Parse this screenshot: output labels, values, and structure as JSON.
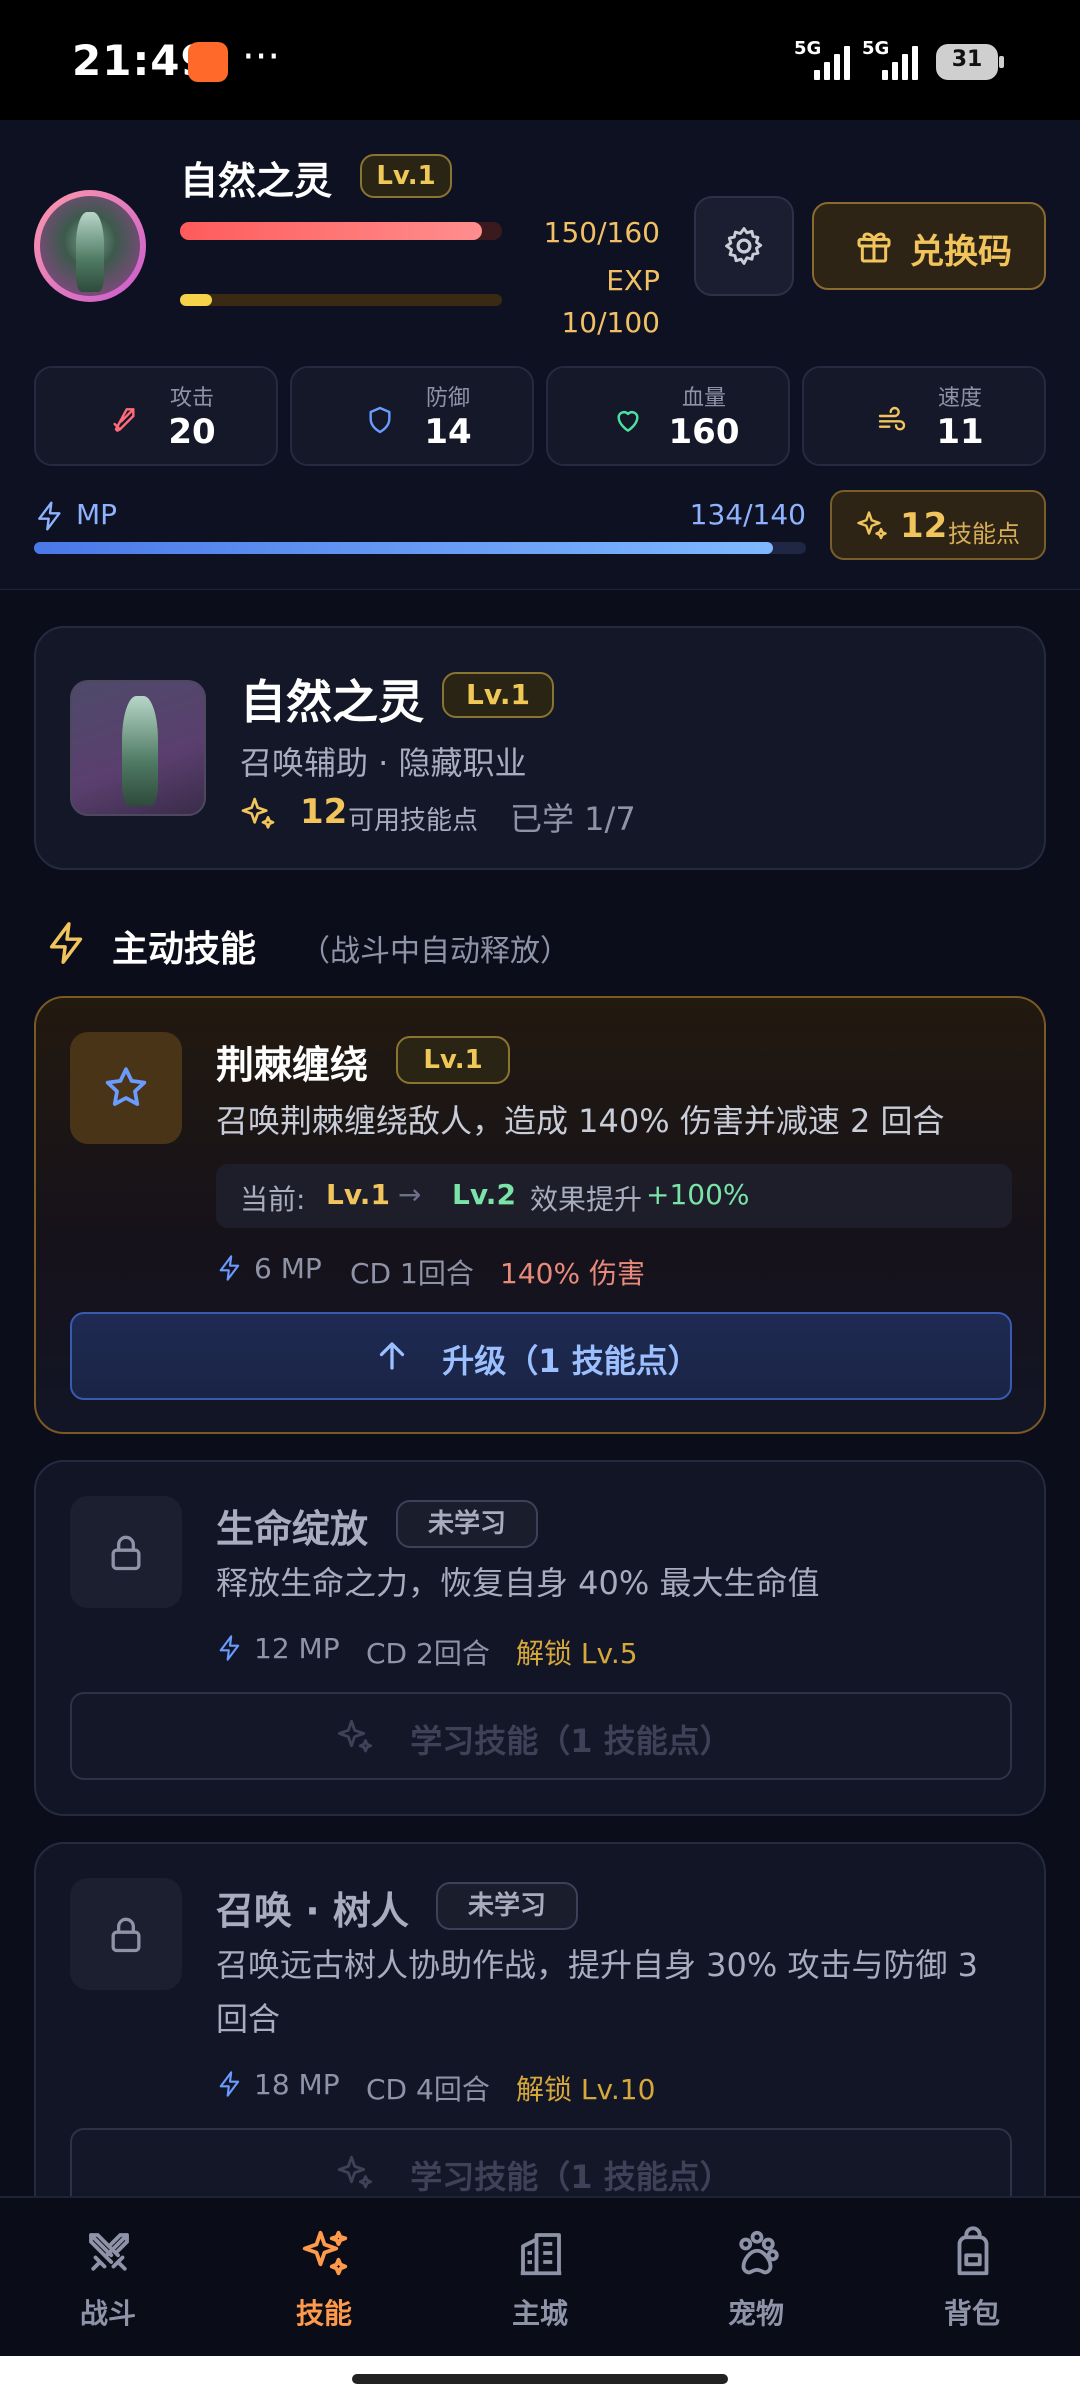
{
  "status": {
    "time": "21:49",
    "more": "···",
    "net1": "5G",
    "net2": "5G",
    "battery": "31"
  },
  "hero": {
    "name": "自然之灵",
    "level": "Lv.1",
    "hp_text": "150/160",
    "hp_ratio": 0.9375,
    "exp_label": "EXP",
    "exp_text": "10/100",
    "exp_ratio": 0.1
  },
  "header": {
    "redeem_label": "兑换码"
  },
  "stats": [
    {
      "label": "攻击",
      "value": "20",
      "icon": "sword-icon",
      "color": "#ff6b7a"
    },
    {
      "label": "防御",
      "value": "14",
      "icon": "shield-icon",
      "color": "#6a9cff"
    },
    {
      "label": "血量",
      "value": "160",
      "icon": "heart-icon",
      "color": "#4be3a2"
    },
    {
      "label": "速度",
      "value": "11",
      "icon": "wind-icon",
      "color": "#f2c55c"
    }
  ],
  "mp": {
    "label": "MP",
    "text": "134/140",
    "ratio": 0.957
  },
  "skill_points": {
    "count": "12",
    "unit": "技能点"
  },
  "class_card": {
    "name": "自然之灵",
    "level": "Lv.1",
    "subtitle": "召唤辅助 · 隐藏职业",
    "points": "12",
    "points_label": "可用技能点",
    "learned": "已学 1/7"
  },
  "section": {
    "title": "主动技能",
    "note": "（战斗中自动释放）"
  },
  "skills": [
    {
      "name": "荆棘缠绕",
      "tag": "Lv.1",
      "desc": "召唤荆棘缠绕敌人，造成 140% 伤害并减速 2 回合",
      "upgrade": {
        "current_label": "当前:",
        "from": "Lv.1",
        "arrow": "→",
        "to": "Lv.2",
        "effect_label": "效果提升",
        "effect_value": "+100%"
      },
      "mp": "6 MP",
      "cd": "CD 1回合",
      "extra": "140% 伤害",
      "button": "升级（1 技能点）"
    },
    {
      "name": "生命绽放",
      "tag": "未学习",
      "desc": "释放生命之力，恢复自身 40% 最大生命值",
      "mp": "12 MP",
      "cd": "CD 2回合",
      "extra": "解锁 Lv.5",
      "button": "学习技能（1 技能点）"
    },
    {
      "name": "召唤 · 树人",
      "tag": "未学习",
      "desc": "召唤远古树人协助作战，提升自身 30% 攻击与防御 3 回合",
      "mp": "18 MP",
      "cd": "CD 4回合",
      "extra": "解锁 Lv.10",
      "button": "学习技能（1 技能点）"
    }
  ],
  "nav": [
    {
      "label": "战斗",
      "icon": "swords-icon",
      "active": false
    },
    {
      "label": "技能",
      "icon": "sparkles-icon",
      "active": true
    },
    {
      "label": "主城",
      "icon": "building-icon",
      "active": false
    },
    {
      "label": "宠物",
      "icon": "paw-icon",
      "active": false
    },
    {
      "label": "背包",
      "icon": "backpack-icon",
      "active": false
    }
  ],
  "colors": {
    "gold": "#f2c55c",
    "accent_orange": "#ff9a4a",
    "mp_blue": "#6a9cff",
    "hp_red": "#ff5b5b"
  }
}
